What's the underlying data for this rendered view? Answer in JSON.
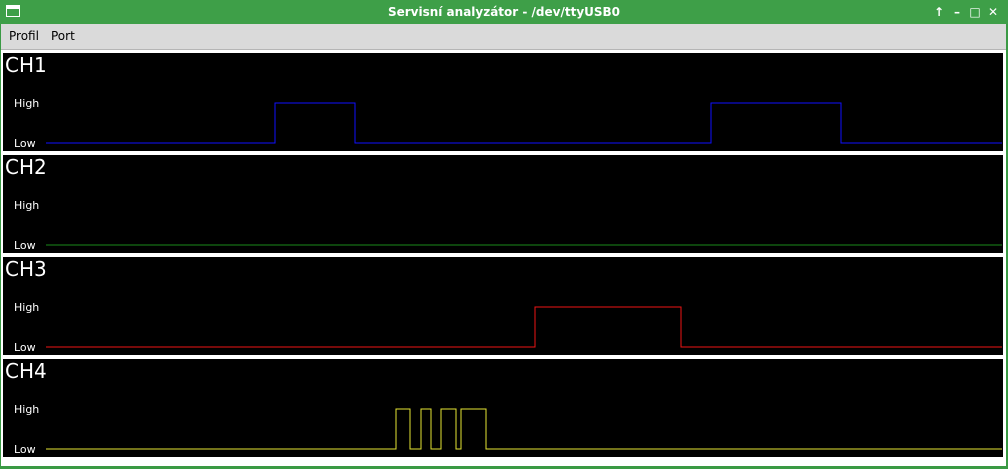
{
  "window": {
    "title": "Servisní analyzátor - /dev/ttyUSB0",
    "controls": [
      "↑",
      "–",
      "□",
      "✕"
    ]
  },
  "menu": [
    "Profil",
    "Port"
  ],
  "levels": {
    "high": "High",
    "low": "Low"
  },
  "channels": [
    {
      "name": "CH1",
      "color": "#1010ff",
      "signal": [
        [
          0,
          0
        ],
        [
          229,
          1
        ],
        [
          309,
          0
        ],
        [
          665,
          1
        ],
        [
          795,
          0
        ]
      ]
    },
    {
      "name": "CH2",
      "color": "#1a8a1a",
      "signal": [
        [
          0,
          0
        ]
      ]
    },
    {
      "name": "CH3",
      "color": "#ee1515",
      "signal": [
        [
          0,
          0
        ],
        [
          489,
          1
        ],
        [
          635,
          0
        ]
      ]
    },
    {
      "name": "CH4",
      "color": "#e6e633",
      "signal": [
        [
          0,
          0
        ],
        [
          350,
          1
        ],
        [
          364,
          0
        ],
        [
          375,
          1
        ],
        [
          385,
          0
        ],
        [
          395,
          1
        ],
        [
          410,
          0
        ],
        [
          415,
          1
        ],
        [
          440,
          0
        ]
      ]
    }
  ]
}
